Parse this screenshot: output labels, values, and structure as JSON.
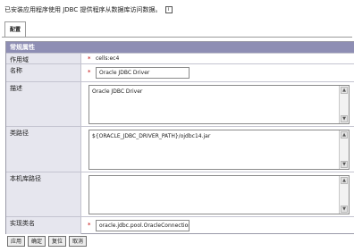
{
  "intro": {
    "text": "已安装应用程序使用 JDBC 提供程序从数据库访问数据。"
  },
  "tab": {
    "label": "配置"
  },
  "section": {
    "title": "常规属性"
  },
  "fields": {
    "scope": {
      "label": "作用域",
      "value": "cells:ec4"
    },
    "name": {
      "label": "名称",
      "value": "Oracle JDBC Driver"
    },
    "description": {
      "label": "描述",
      "value": "Oracle JDBC Driver"
    },
    "classpath": {
      "label": "类路径",
      "value": "${ORACLE_JDBC_DRIVER_PATH}/ojdbc14.jar"
    },
    "native_path": {
      "label": "本机库路径",
      "value": ""
    },
    "impl_class": {
      "label": "实现类名",
      "value": "oracle.jdbc.pool.OracleConnectionP"
    }
  },
  "required_marker": "*",
  "buttons": {
    "apply": "应用",
    "ok": "确定",
    "reset": "复位",
    "cancel": "取消"
  },
  "colors": {
    "section_bg": "#8e8eb4",
    "label_bg": "#e6e6ee",
    "required": "#c00000"
  }
}
